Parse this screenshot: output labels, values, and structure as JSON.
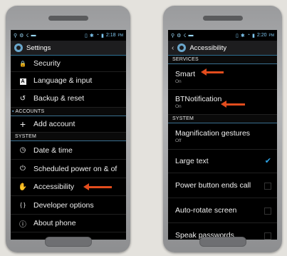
{
  "left": {
    "status": {
      "time": "2:18",
      "ampm": "PM"
    },
    "title": "Settings",
    "items": [
      {
        "icon": "lock-icon",
        "glyph": "🔒",
        "label": "Security"
      },
      {
        "icon": "keyboard-icon",
        "glyph": "A",
        "label": "Language & input"
      },
      {
        "icon": "backup-icon",
        "glyph": "↺",
        "label": "Backup & reset"
      }
    ],
    "section_accounts": "ACCOUNTS",
    "add_account": {
      "icon": "plus-icon",
      "glyph": "+",
      "label": "Add account"
    },
    "section_system": "SYSTEM",
    "system_items": [
      {
        "icon": "clock-icon",
        "glyph": "◷",
        "label": "Date & time"
      },
      {
        "icon": "power-icon",
        "glyph": "⏻",
        "label": "Scheduled power on & of"
      },
      {
        "icon": "hand-icon",
        "glyph": "✋",
        "label": "Accessibility"
      },
      {
        "icon": "braces-icon",
        "glyph": "{ }",
        "label": "Developer options"
      },
      {
        "icon": "info-icon",
        "glyph": "ⓘ",
        "label": "About phone"
      }
    ]
  },
  "right": {
    "status": {
      "time": "2:20",
      "ampm": "PM"
    },
    "title": "Accessibility",
    "section_services": "SERVICES",
    "services": [
      {
        "label": "Smart",
        "sub": "On"
      },
      {
        "label": "BTNotification",
        "sub": "On"
      }
    ],
    "section_system": "SYSTEM",
    "system": [
      {
        "label": "Magnification gestures",
        "sub": "Off",
        "checked": null
      },
      {
        "label": "Large text",
        "sub": "",
        "checked": true
      },
      {
        "label": "Power button ends call",
        "sub": "",
        "checked": false
      },
      {
        "label": "Auto-rotate screen",
        "sub": "",
        "checked": false
      },
      {
        "label": "Speak passwords",
        "sub": "",
        "checked": false
      }
    ]
  }
}
